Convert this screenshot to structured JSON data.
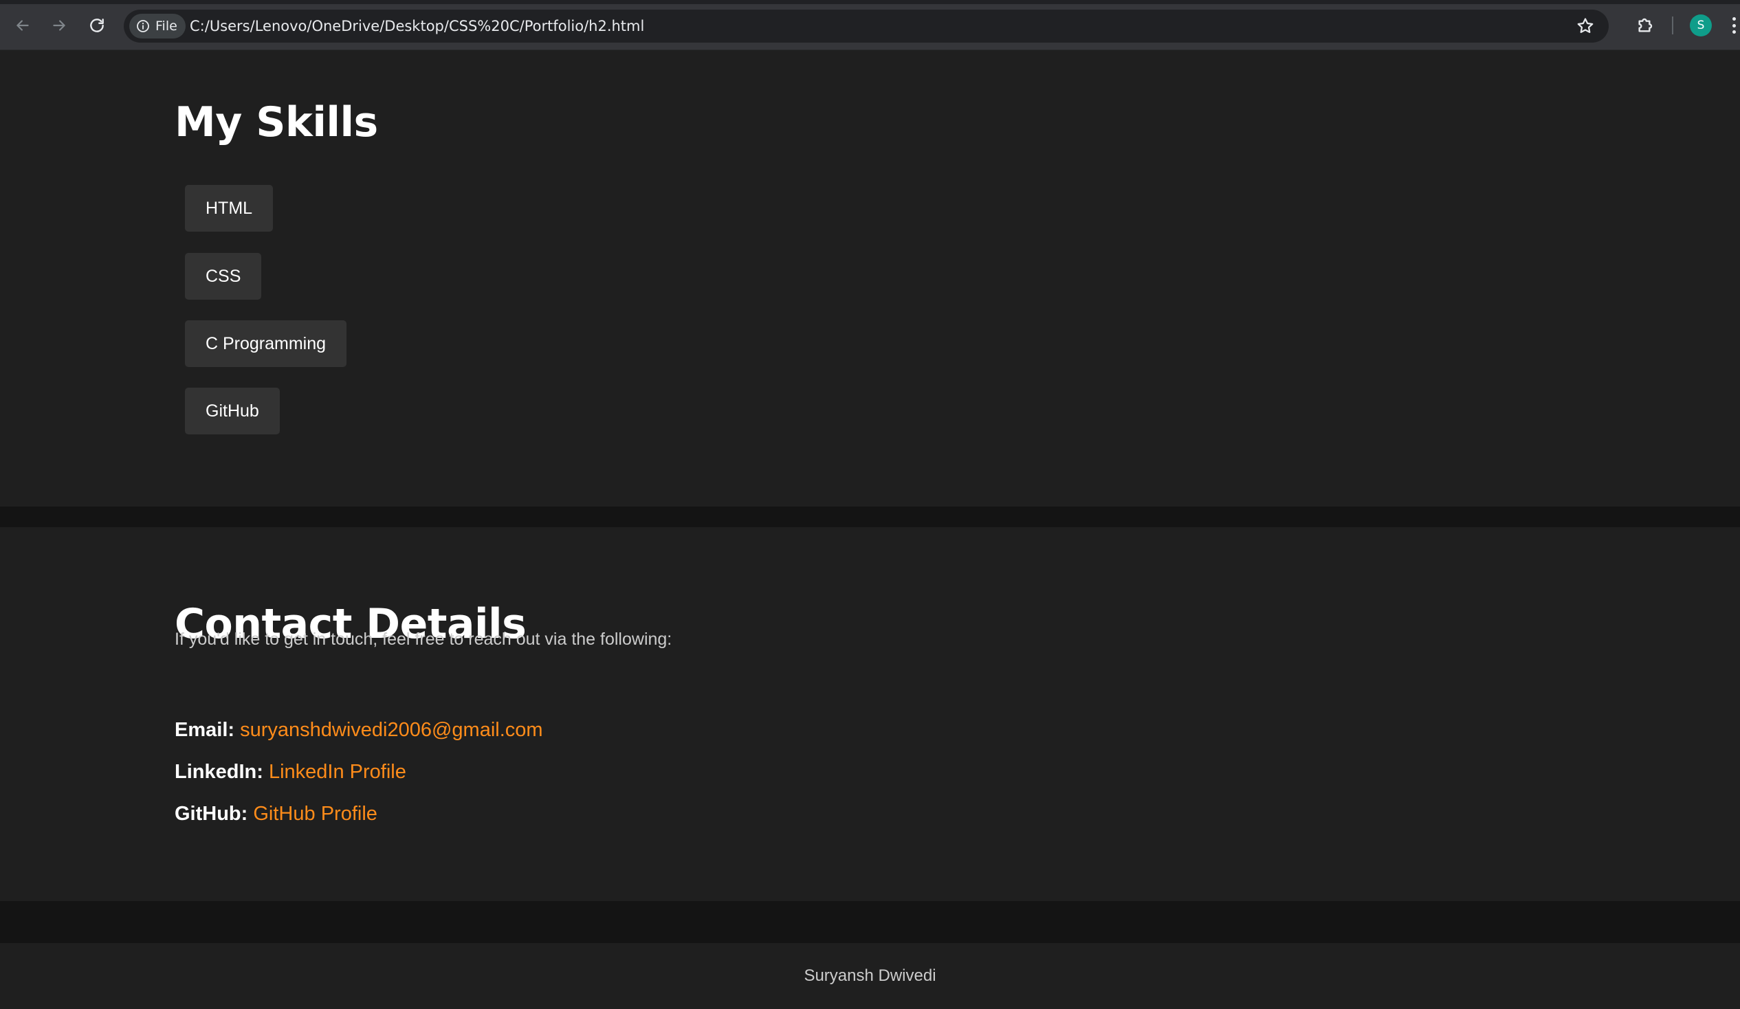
{
  "browser": {
    "file_chip_label": "File",
    "url": "C:/Users/Lenovo/OneDrive/Desktop/CSS%20C/Portfolio/h2.html",
    "profile_initial": "S",
    "icons": {
      "back": "arrow-left-icon",
      "forward": "arrow-right-icon",
      "reload": "reload-icon",
      "info": "info-icon",
      "bookmark": "star-icon",
      "extensions": "puzzle-icon",
      "menu": "kebab-menu-icon"
    }
  },
  "skills": {
    "title": "My Skills",
    "items": [
      {
        "label": "HTML"
      },
      {
        "label": "CSS"
      },
      {
        "label": "C Programming"
      },
      {
        "label": "GitHub"
      }
    ]
  },
  "contact": {
    "title": "Contact Details",
    "intro": "If you'd like to get in touch, feel free to reach out via the following:",
    "email_label": "Email:",
    "email_value": "suryanshdwivedi2006@gmail.com",
    "linkedin_label": "LinkedIn:",
    "linkedin_value": "LinkedIn Profile",
    "github_label": "GitHub:",
    "github_value": "GitHub Profile"
  },
  "footer": {
    "text": "Suryansh Dwivedi"
  },
  "colors": {
    "page_bg": "#1f1f1f",
    "band_bg": "#141414",
    "pill_bg": "#333333",
    "link": "#ff8c1a",
    "profile": "#0f9d8a"
  }
}
